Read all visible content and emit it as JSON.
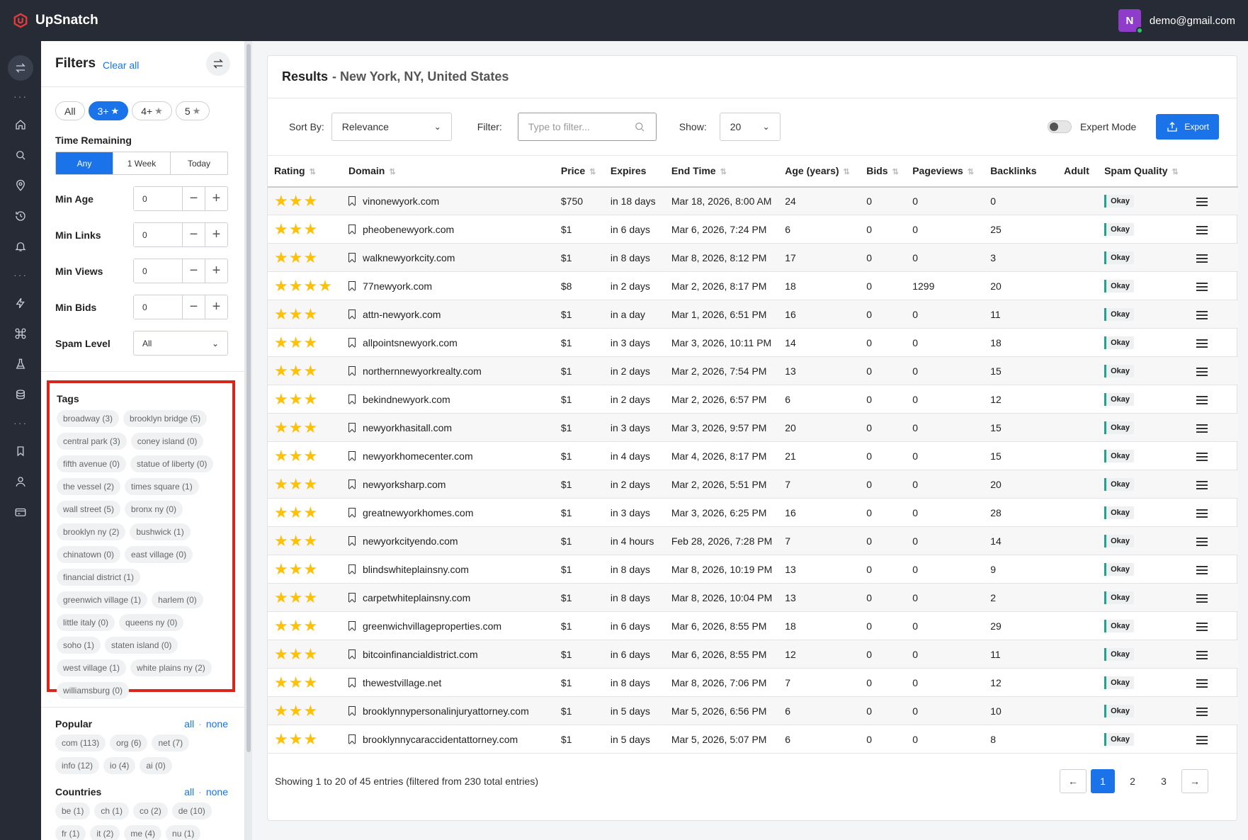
{
  "app": {
    "brand": "UpSnatch",
    "user_initial": "N",
    "user_email": "demo@gmail.com"
  },
  "sidebar": {
    "title": "Filters",
    "clear_all": "Clear all",
    "rating_pills": [
      {
        "label": "All",
        "star": false,
        "active": false
      },
      {
        "label": "3+",
        "star": true,
        "active": true
      },
      {
        "label": "4+",
        "star": true,
        "active": false
      },
      {
        "label": "5",
        "star": true,
        "active": false
      }
    ],
    "time_remaining_label": "Time Remaining",
    "time_options": [
      "Any",
      "1 Week",
      "Today"
    ],
    "time_selected": "Any",
    "numeric_filters": [
      {
        "label": "Min Age",
        "value": "0"
      },
      {
        "label": "Min Links",
        "value": "0"
      },
      {
        "label": "Min Views",
        "value": "0"
      },
      {
        "label": "Min Bids",
        "value": "0"
      }
    ],
    "spam_level_label": "Spam Level",
    "spam_level_value": "All",
    "tags_label": "Tags",
    "tags": [
      "broadway (3)",
      "brooklyn bridge (5)",
      "central park (3)",
      "coney island (0)",
      "fifth avenue (0)",
      "statue of liberty (0)",
      "the vessel (2)",
      "times square (1)",
      "wall street (5)",
      "bronx ny (0)",
      "brooklyn ny (2)",
      "bushwick (1)",
      "chinatown (0)",
      "east village (0)",
      "financial district (1)",
      "greenwich village (1)",
      "harlem (0)",
      "little italy (0)",
      "queens ny (0)",
      "soho (1)",
      "staten island (0)",
      "west village (1)",
      "white plains ny (2)",
      "williamsburg (0)"
    ],
    "popular_label": "Popular",
    "popular": [
      "com (113)",
      "org (6)",
      "net (7)",
      "info (12)",
      "io (4)",
      "ai (0)"
    ],
    "countries_label": "Countries",
    "countries": [
      "be (1)",
      "ch (1)",
      "co (2)",
      "de (10)",
      "fr (1)",
      "it (2)",
      "me (4)",
      "nu (1)"
    ],
    "link_all": "all",
    "link_none": "none"
  },
  "results": {
    "title": "Results",
    "location": "- New York, NY, United States",
    "sort_label": "Sort By:",
    "sort_value": "Relevance",
    "filter_label": "Filter:",
    "filter_placeholder": "Type to filter...",
    "show_label": "Show:",
    "show_value": "20",
    "expert_mode_label": "Expert Mode",
    "export_label": "Export",
    "columns": [
      "Rating",
      "Domain",
      "Price",
      "Expires",
      "End Time",
      "Age (years)",
      "Bids",
      "Pageviews",
      "Backlinks",
      "Adult",
      "Spam Quality"
    ],
    "rows": [
      {
        "stars": 3,
        "domain": "vinonewyork.com",
        "price": "$750",
        "expires": "in 18 days",
        "end": "Mar 18, 2026, 8:00 AM",
        "age": "24",
        "bids": "0",
        "views": "0",
        "links": "0",
        "spam": "Okay"
      },
      {
        "stars": 3,
        "domain": "pheobenewyork.com",
        "price": "$1",
        "expires": "in 6 days",
        "end": "Mar 6, 2026, 7:24 PM",
        "age": "6",
        "bids": "0",
        "views": "0",
        "links": "25",
        "spam": "Okay"
      },
      {
        "stars": 3,
        "domain": "walknewyorkcity.com",
        "price": "$1",
        "expires": "in 8 days",
        "end": "Mar 8, 2026, 8:12 PM",
        "age": "17",
        "bids": "0",
        "views": "0",
        "links": "3",
        "spam": "Okay"
      },
      {
        "stars": 4,
        "domain": "77newyork.com",
        "price": "$8",
        "expires": "in 2 days",
        "end": "Mar 2, 2026, 8:17 PM",
        "age": "18",
        "bids": "0",
        "views": "1299",
        "links": "20",
        "spam": "Okay"
      },
      {
        "stars": 3,
        "domain": "attn-newyork.com",
        "price": "$1",
        "expires": "in a day",
        "end": "Mar 1, 2026, 6:51 PM",
        "age": "16",
        "bids": "0",
        "views": "0",
        "links": "11",
        "spam": "Okay"
      },
      {
        "stars": 3,
        "domain": "allpointsnewyork.com",
        "price": "$1",
        "expires": "in 3 days",
        "end": "Mar 3, 2026, 10:11 PM",
        "age": "14",
        "bids": "0",
        "views": "0",
        "links": "18",
        "spam": "Okay"
      },
      {
        "stars": 3,
        "domain": "northernnewyorkrealty.com",
        "price": "$1",
        "expires": "in 2 days",
        "end": "Mar 2, 2026, 7:54 PM",
        "age": "13",
        "bids": "0",
        "views": "0",
        "links": "15",
        "spam": "Okay"
      },
      {
        "stars": 3,
        "domain": "bekindnewyork.com",
        "price": "$1",
        "expires": "in 2 days",
        "end": "Mar 2, 2026, 6:57 PM",
        "age": "6",
        "bids": "0",
        "views": "0",
        "links": "12",
        "spam": "Okay"
      },
      {
        "stars": 3,
        "domain": "newyorkhasitall.com",
        "price": "$1",
        "expires": "in 3 days",
        "end": "Mar 3, 2026, 9:57 PM",
        "age": "20",
        "bids": "0",
        "views": "0",
        "links": "15",
        "spam": "Okay"
      },
      {
        "stars": 3,
        "domain": "newyorkhomecenter.com",
        "price": "$1",
        "expires": "in 4 days",
        "end": "Mar 4, 2026, 8:17 PM",
        "age": "21",
        "bids": "0",
        "views": "0",
        "links": "15",
        "spam": "Okay"
      },
      {
        "stars": 3,
        "domain": "newyorksharp.com",
        "price": "$1",
        "expires": "in 2 days",
        "end": "Mar 2, 2026, 5:51 PM",
        "age": "7",
        "bids": "0",
        "views": "0",
        "links": "20",
        "spam": "Okay"
      },
      {
        "stars": 3,
        "domain": "greatnewyorkhomes.com",
        "price": "$1",
        "expires": "in 3 days",
        "end": "Mar 3, 2026, 6:25 PM",
        "age": "16",
        "bids": "0",
        "views": "0",
        "links": "28",
        "spam": "Okay"
      },
      {
        "stars": 3,
        "domain": "newyorkcityendo.com",
        "price": "$1",
        "expires": "in 4 hours",
        "end": "Feb 28, 2026, 7:28 PM",
        "age": "7",
        "bids": "0",
        "views": "0",
        "links": "14",
        "spam": "Okay"
      },
      {
        "stars": 3,
        "domain": "blindswhiteplainsny.com",
        "price": "$1",
        "expires": "in 8 days",
        "end": "Mar 8, 2026, 10:19 PM",
        "age": "13",
        "bids": "0",
        "views": "0",
        "links": "9",
        "spam": "Okay"
      },
      {
        "stars": 3,
        "domain": "carpetwhiteplainsny.com",
        "price": "$1",
        "expires": "in 8 days",
        "end": "Mar 8, 2026, 10:04 PM",
        "age": "13",
        "bids": "0",
        "views": "0",
        "links": "2",
        "spam": "Okay"
      },
      {
        "stars": 3,
        "domain": "greenwichvillageproperties.com",
        "price": "$1",
        "expires": "in 6 days",
        "end": "Mar 6, 2026, 8:55 PM",
        "age": "18",
        "bids": "0",
        "views": "0",
        "links": "29",
        "spam": "Okay"
      },
      {
        "stars": 3,
        "domain": "bitcoinfinancialdistrict.com",
        "price": "$1",
        "expires": "in 6 days",
        "end": "Mar 6, 2026, 8:55 PM",
        "age": "12",
        "bids": "0",
        "views": "0",
        "links": "11",
        "spam": "Okay"
      },
      {
        "stars": 3,
        "domain": "thewestvillage.net",
        "price": "$1",
        "expires": "in 8 days",
        "end": "Mar 8, 2026, 7:06 PM",
        "age": "7",
        "bids": "0",
        "views": "0",
        "links": "12",
        "spam": "Okay"
      },
      {
        "stars": 3,
        "domain": "brooklynnypersonalinjuryattorney.com",
        "price": "$1",
        "expires": "in 5 days",
        "end": "Mar 5, 2026, 6:56 PM",
        "age": "6",
        "bids": "0",
        "views": "0",
        "links": "10",
        "spam": "Okay"
      },
      {
        "stars": 3,
        "domain": "brooklynnycaraccidentattorney.com",
        "price": "$1",
        "expires": "in 5 days",
        "end": "Mar 5, 2026, 5:07 PM",
        "age": "6",
        "bids": "0",
        "views": "0",
        "links": "8",
        "spam": "Okay"
      }
    ],
    "footer_info": "Showing 1 to 20 of 45 entries (filtered from 230 total entries)",
    "pages": [
      "1",
      "2",
      "3"
    ],
    "current_page": "1"
  },
  "colors": {
    "accent": "#1a73e8",
    "topbar": "#262b36",
    "highlight_border": "#d9261c",
    "star": "#ffc107",
    "okay_bar": "#1aa688"
  }
}
